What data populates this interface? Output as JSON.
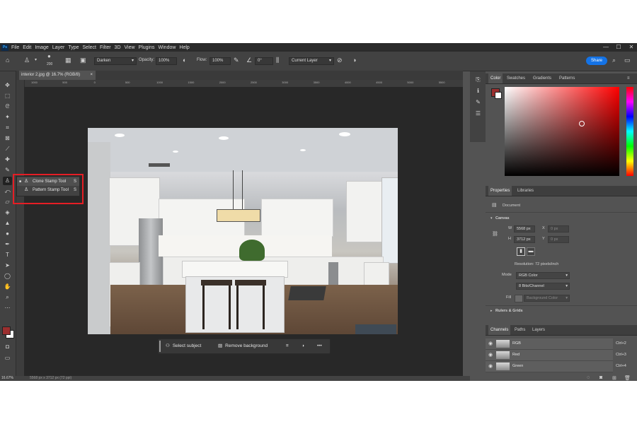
{
  "menu": {
    "logo": "Ps",
    "items": [
      "File",
      "Edit",
      "Image",
      "Layer",
      "Type",
      "Select",
      "Filter",
      "3D",
      "View",
      "Plugins",
      "Window",
      "Help"
    ],
    "window_controls": [
      "—",
      "☐",
      "✕"
    ]
  },
  "options": {
    "brush_size": "200",
    "mode": "Darken",
    "opacity_label": "Opacity:",
    "opacity_value": "100%",
    "flow_label": "Flow:",
    "flow_value": "100%",
    "angle_value": "0°",
    "sample": "Current Layer",
    "share_label": "Share"
  },
  "document_tab": {
    "title": "interior 2.jpg @ 16.7% (RGB/8)",
    "close": "×"
  },
  "ruler_ticks": [
    "1000",
    "500",
    "0",
    "500",
    "1000",
    "1500",
    "2000",
    "2500",
    "3000",
    "3500",
    "4000",
    "4500",
    "5000",
    "5500"
  ],
  "flyout": {
    "items": [
      {
        "label": "Clone Stamp Tool",
        "shortcut": "S"
      },
      {
        "label": "Pattern Stamp Tool",
        "shortcut": "S"
      }
    ]
  },
  "contextual_bar": {
    "select_subject": "Select subject",
    "remove_background": "Remove background",
    "more": "•••"
  },
  "status": {
    "zoom": "16.67%",
    "dimensions": "5568 px x 3712 px (72 ppi)"
  },
  "color_panel": {
    "tabs": [
      "Color",
      "Swatches",
      "Gradients",
      "Patterns"
    ],
    "foreground": "#9b2f2f",
    "background": "#ffffff",
    "hue": "#ff0000"
  },
  "properties_panel": {
    "tabs": [
      "Properties",
      "Libraries"
    ],
    "document_label": "Document",
    "canvas_label": "Canvas",
    "w_label": "W",
    "w_value": "5568 px",
    "h_label": "H",
    "h_value": "3712 px",
    "x_label": "X",
    "x_value": "0 px",
    "y_label": "Y",
    "y_value": "0 px",
    "resolution": "Resolution: 72 pixels/inch",
    "mode_label": "Mode",
    "mode_value": "RGB Color",
    "bits_value": "8 Bits/Channel",
    "fill_label": "Fill",
    "fill_value": "Background Color",
    "rulers_grids": "Rulers & Grids"
  },
  "channels_panel": {
    "tabs": [
      "Channels",
      "Paths",
      "Layers"
    ],
    "rows": [
      {
        "name": "RGB",
        "shortcut": "Ctrl+2"
      },
      {
        "name": "Red",
        "shortcut": "Ctrl+3"
      },
      {
        "name": "Green",
        "shortcut": "Ctrl+4"
      }
    ]
  }
}
